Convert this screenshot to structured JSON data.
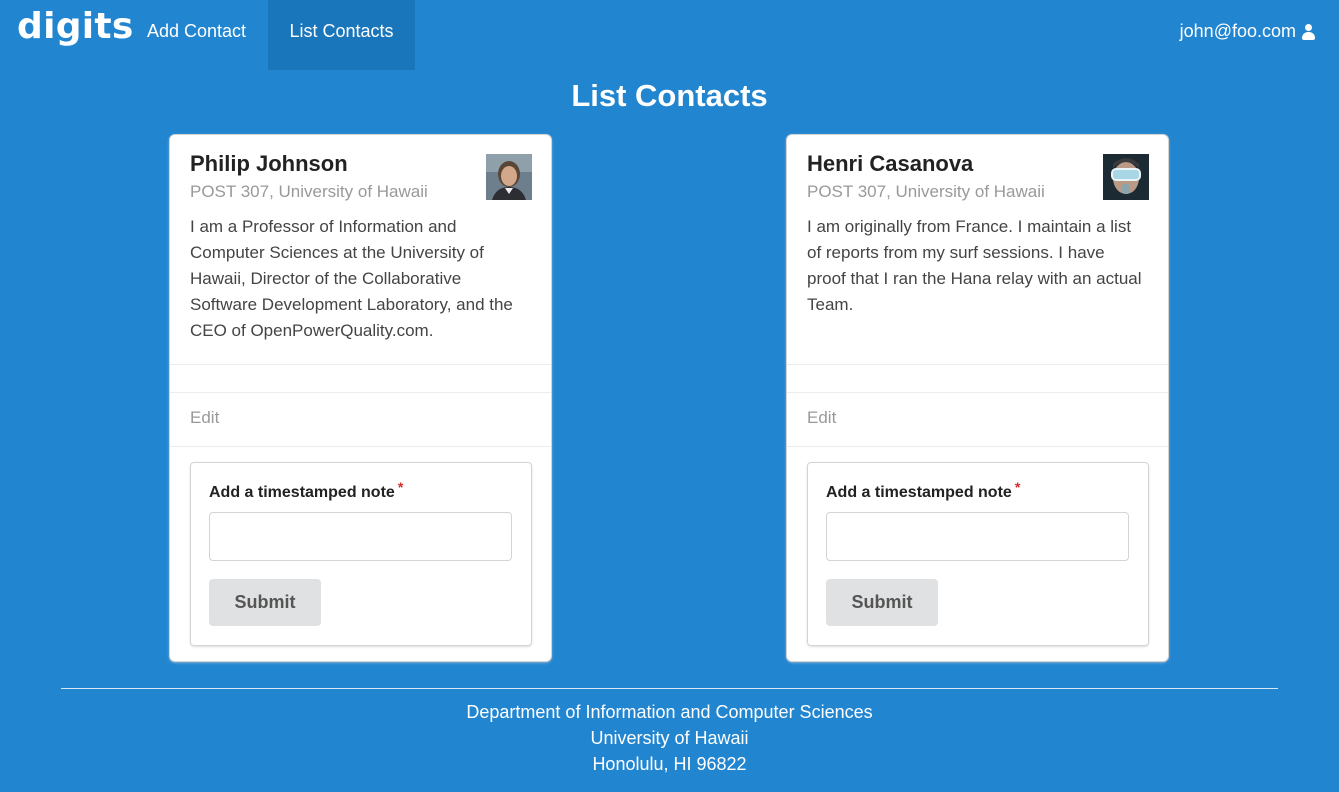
{
  "nav": {
    "brand": "digits",
    "items": [
      {
        "label": "Add Contact",
        "active": false
      },
      {
        "label": "List Contacts",
        "active": true
      }
    ],
    "user": {
      "email": "john@foo.com",
      "icon": "user-icon"
    }
  },
  "page": {
    "title": "List Contacts"
  },
  "contacts": [
    {
      "name": "Philip Johnson",
      "address": "POST 307, University of Hawaii",
      "description": "I am a Professor of Information and Computer Sciences at the University of Hawaii, Director of the Collaborative Software Development Laboratory, and the CEO of OpenPowerQuality.com.",
      "edit_label": "Edit",
      "note_label": "Add a timestamped note",
      "required_mark": "*",
      "note_value": "",
      "submit_label": "Submit"
    },
    {
      "name": "Henri Casanova",
      "address": "POST 307, University of Hawaii",
      "description": "I am originally from France. I maintain a list of reports from my surf sessions. I have proof that I ran the Hana relay with an actual Team.",
      "edit_label": "Edit",
      "note_label": "Add a timestamped note",
      "required_mark": "*",
      "note_value": "",
      "submit_label": "Submit"
    }
  ],
  "footer": {
    "line1": "Department of Information and Computer Sciences",
    "line2": "University of Hawaii",
    "line3": "Honolulu, HI 96822"
  },
  "colors": {
    "background": "#2185d0",
    "active_nav": "#1a76bb",
    "button": "#e0e1e2",
    "required": "#db2828"
  }
}
